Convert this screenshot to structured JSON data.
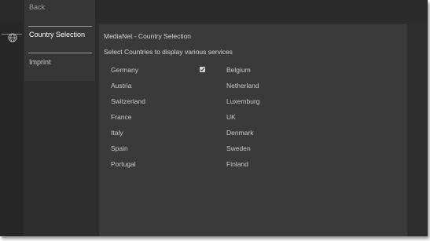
{
  "menu": {
    "back_label": "Back",
    "country_label": "Country Selection",
    "imprint_label": "Imprint"
  },
  "panel": {
    "title": "MediaNet - Country Selection",
    "subtitle": "Select Countries to display various services"
  },
  "countries_left": [
    "Germany",
    "Austria",
    "Switzerland",
    "France",
    "Italy",
    "Spain",
    "Portugal"
  ],
  "countries_right": [
    "Belgium",
    "Netherland",
    "Luxemburg",
    "UK",
    "Denmark",
    "Sweden",
    "Finland"
  ],
  "checked": [
    "Germany"
  ],
  "colors": {
    "background": "#2d2d2d",
    "panel": "#3a3a3a",
    "menu": "#363636",
    "text": "#c9c9c9"
  },
  "icons": {
    "sidebar": "globe-icon",
    "checkbox": "checkbox-checked-icon"
  }
}
